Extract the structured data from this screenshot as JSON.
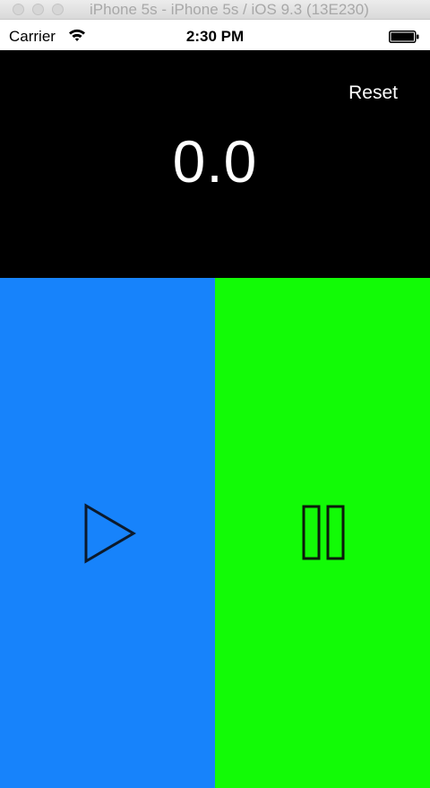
{
  "window": {
    "title": "iPhone 5s - iPhone 5s / iOS 9.3 (13E230)"
  },
  "status_bar": {
    "carrier": "Carrier",
    "time": "2:30 PM"
  },
  "timer": {
    "reset_label": "Reset",
    "display": "0.0"
  },
  "icons": {
    "play": "play-icon",
    "pause": "pause-icon",
    "wifi": "wifi-icon",
    "battery": "battery-icon"
  },
  "colors": {
    "timer_background": "#000000",
    "play_background": "#1783fb",
    "pause_background": "#12fb06"
  }
}
